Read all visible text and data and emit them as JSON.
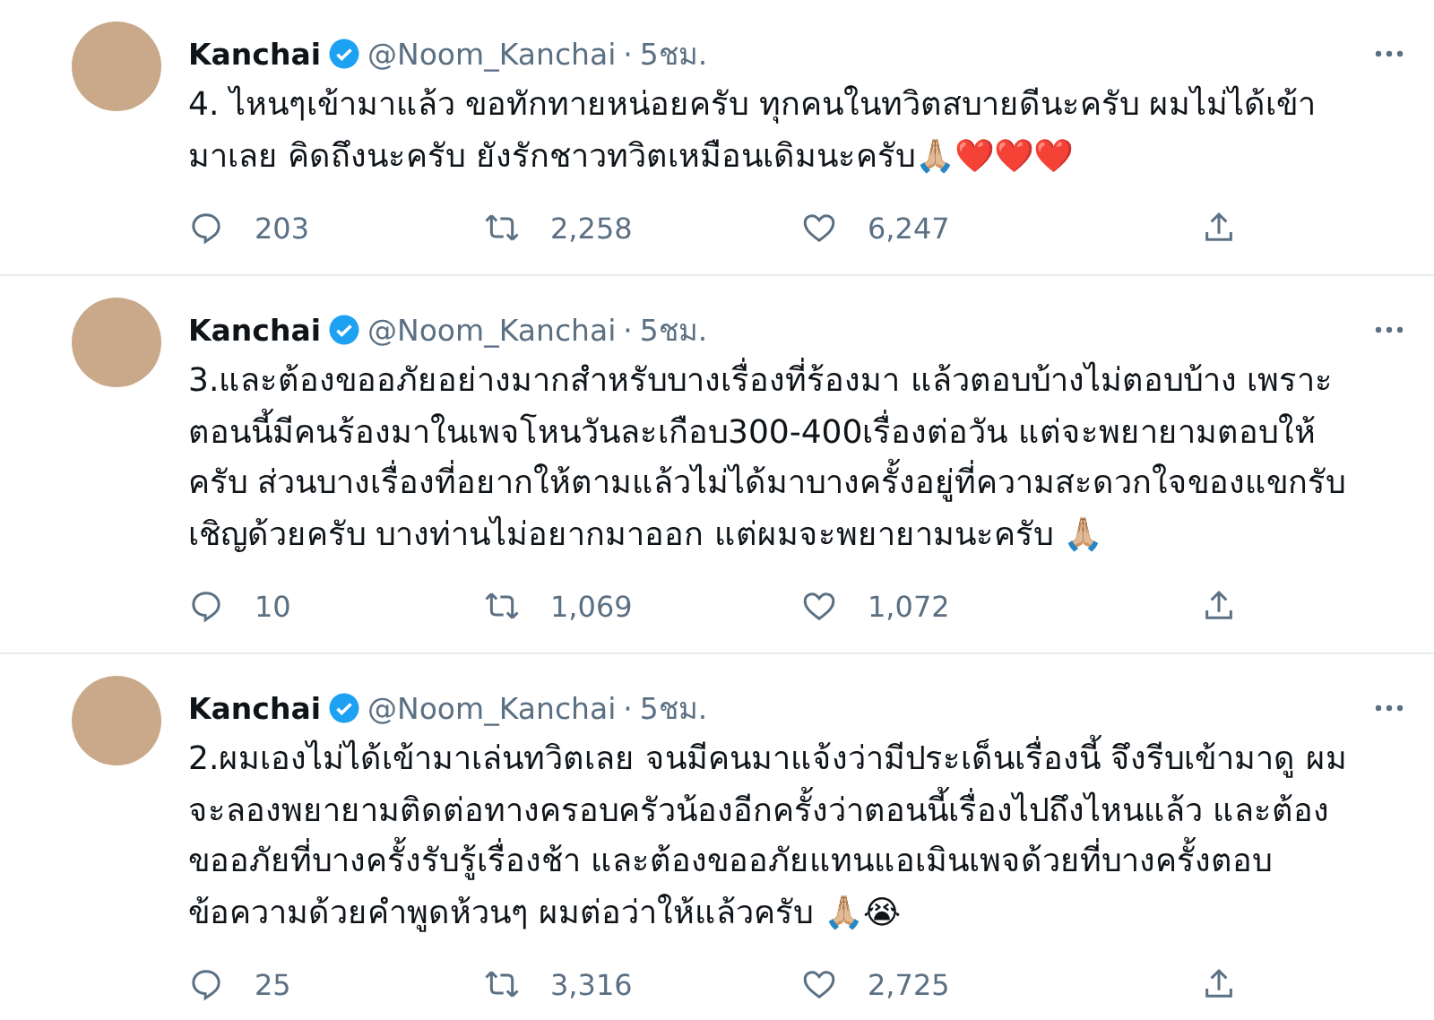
{
  "tweets": [
    {
      "name": "Kanchai",
      "handle": "@Noom_Kanchai",
      "separator": "·",
      "time": "5ชม.",
      "verified": true,
      "text": "4. ไหนๆเข้ามาแล้ว ขอทักทายหน่อยครับ ทุกคนในทวิตสบายดีนะครับ ผมไม่ได้เข้า\nมาเลย คิดถึงนะครับ ยังรักชาวทวิตเหมือนเดิมนะครับ🙏🏼❤️❤️❤️",
      "replies": "203",
      "retweets": "2,258",
      "likes": "6,247"
    },
    {
      "name": "Kanchai",
      "handle": "@Noom_Kanchai",
      "separator": "·",
      "time": "5ชม.",
      "verified": true,
      "text": "3.และต้องขออภัยอย่างมากสำหรับบางเรื่องที่ร้องมา แล้วตอบบ้างไม่ตอบบ้าง เพราะ\nตอนนี้มีคนร้องมาในเพจโหนวันละเกือบ300-400เรื่องต่อวัน แต่จะพยายามตอบให้\nครับ ส่วนบางเรื่องที่อยากให้ตามแล้วไม่ได้มาบางครั้งอยู่ที่ความสะดวกใจของแขกรับ\nเชิญด้วยครับ บางท่านไม่อยากมาออก แต่ผมจะพยายามนะครับ 🙏🏼",
      "replies": "10",
      "retweets": "1,069",
      "likes": "1,072"
    },
    {
      "name": "Kanchai",
      "handle": "@Noom_Kanchai",
      "separator": "·",
      "time": "5ชม.",
      "verified": true,
      "text": "2.ผมเองไม่ได้เข้ามาเล่นทวิตเลย จนมีคนมาแจ้งว่ามีประเด็นเรื่องนี้ จึงรีบเข้ามาดู ผม\nจะลองพยายามติดต่อทางครอบครัวน้องอีกครั้งว่าตอนนี้เรื่องไปถึงไหนแล้ว และต้อง\nขออภัยที่บางครั้งรับรู้เรื่องช้า และต้องขออภัยแทนแอเมินเพจด้วยที่บางครั้งตอบ\nข้อความด้วยคำพูดห้วนๆ ผมต่อว่าให้แล้วครับ 🙏🏼😭",
      "replies": "25",
      "retweets": "3,316",
      "likes": "2,725"
    }
  ]
}
